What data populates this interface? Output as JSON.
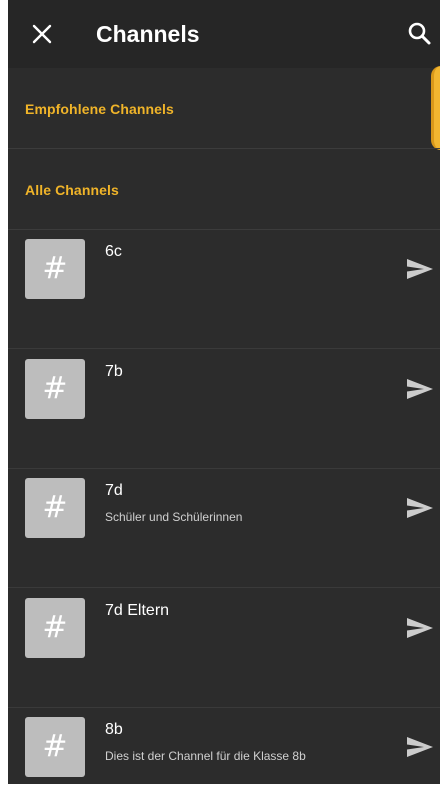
{
  "header": {
    "title": "Channels",
    "close_icon": "close-icon",
    "search_icon": "search-icon"
  },
  "sections": {
    "recommended_label": "Empfohlene Channels",
    "all_label": "Alle Channels"
  },
  "channels": [
    {
      "name": "6c",
      "description": "",
      "icon": "hash-icon"
    },
    {
      "name": "7b",
      "description": "",
      "icon": "hash-icon"
    },
    {
      "name": "7d",
      "description": "Schüler und Schülerinnen",
      "icon": "hash-icon"
    },
    {
      "name": "7d Eltern",
      "description": "",
      "icon": "hash-icon"
    },
    {
      "name": "8b",
      "description": "Dies ist der Channel für die Klasse 8b",
      "icon": "hash-icon"
    }
  ],
  "channel_icon_glyph": "#",
  "colors": {
    "background": "#2c2c2c",
    "appbar": "#262626",
    "accent": "#f0b429",
    "icon_bg": "#bdbdbd",
    "send_icon": "#cccccc"
  }
}
